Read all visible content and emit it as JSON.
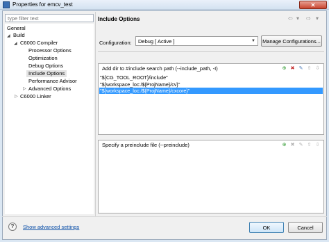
{
  "window": {
    "title": "Properties for emcv_test",
    "close_label": "✕"
  },
  "filter": {
    "placeholder": "type filter text"
  },
  "tree": {
    "general": "General",
    "build": "Build",
    "c6000_compiler": "C6000 Compiler",
    "processor_options": "Processor Options",
    "optimization": "Optimization",
    "debug_options": "Debug Options",
    "include_options": "Include Options",
    "performance_advisor": "Performance Advisor",
    "advanced_options": "Advanced Options",
    "c6000_linker": "C6000 Linker"
  },
  "panel": {
    "title": "Include Options",
    "nav": {
      "back": "⇦",
      "back_menu": "▾",
      "forward": "⇨",
      "forward_menu": "▾"
    },
    "configuration_label": "Configuration:",
    "configuration_value": "Debug  [ Active ]",
    "manage_button": "Manage Configurations...",
    "include_path": {
      "header": "Add dir to #include search path (--include_path, -I)",
      "items": [
        "\"${CG_TOOL_ROOT}/include\"",
        "\"${workspace_loc:/${ProjName}/cv}\"",
        "\"${workspace_loc:/${ProjName}/cxcore}\""
      ],
      "selected_index": 2
    },
    "preinclude": {
      "header": "Specify a preinclude file (--preinclude)",
      "items": []
    }
  },
  "footer": {
    "help_label": "?",
    "advanced_link": "Show advanced settings",
    "ok": "OK",
    "cancel": "Cancel"
  },
  "colors": {
    "selection": "#3399ff",
    "link": "#0b4fa8"
  },
  "icons": {
    "tool_add": "add-icon",
    "tool_delete": "delete-icon",
    "tool_edit": "edit-icon",
    "tool_move_up": "move-up-icon",
    "tool_move_down": "move-down-icon"
  }
}
